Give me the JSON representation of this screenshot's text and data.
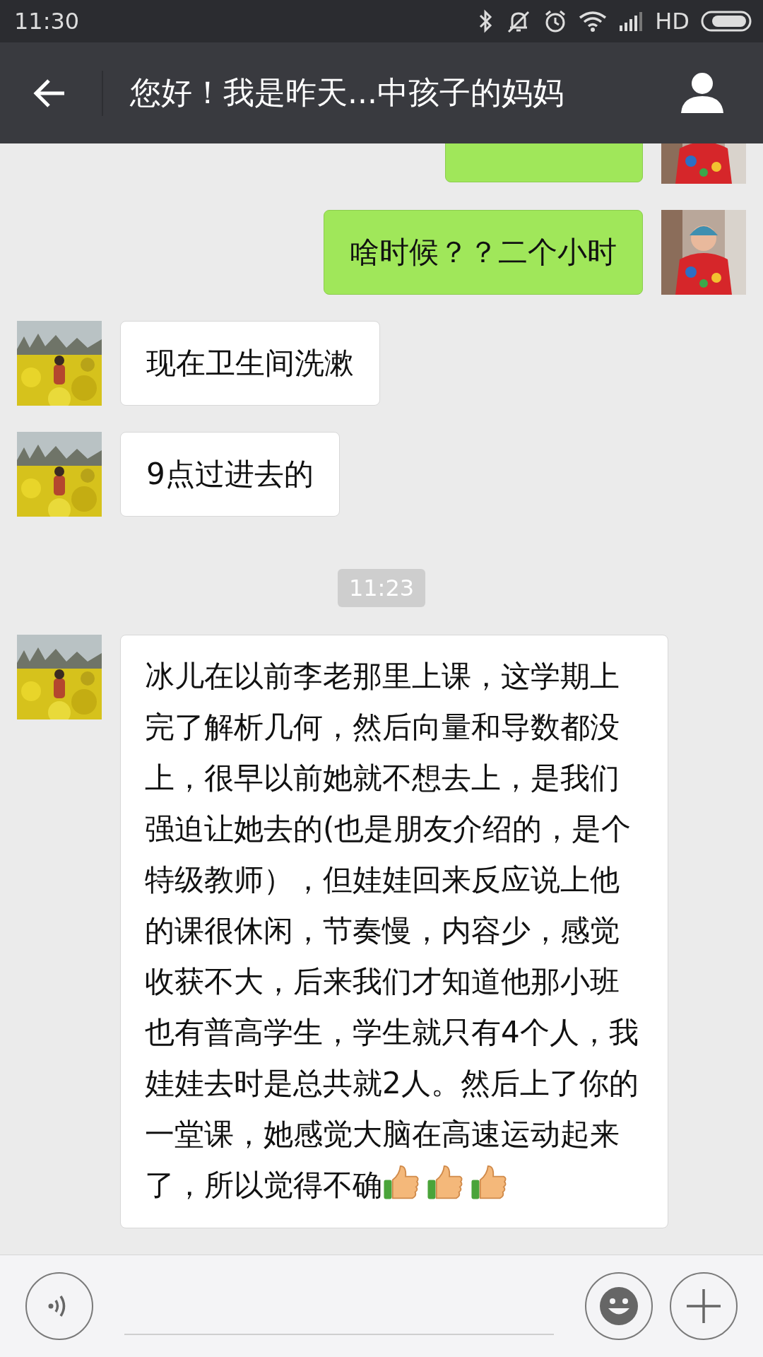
{
  "status_bar": {
    "time": "11:30",
    "network": "HD"
  },
  "header": {
    "title": "您好！我是昨天...中孩子的妈妈"
  },
  "messages": [
    {
      "kind": "sent"
    },
    {
      "kind": "sent",
      "text": "啥时候？？二个小时"
    },
    {
      "kind": "received",
      "text": "现在卫生间洗漱"
    },
    {
      "kind": "received",
      "text": "9点过进去的"
    },
    {
      "kind": "time",
      "text": "11:23"
    },
    {
      "kind": "received",
      "text": "冰儿在以前李老那里上课，这学期上完了解析几何，然后向量和导数都没上，很早以前她就不想去上，是我们强迫让她去的(也是朋友介绍的，是个特级教师），但娃娃回来反应说上他的课很休闲，节奏慢，内容少，感觉收获不大，后来我们才知道他那小班也有普高学生，学生就只有4个人，我娃娃去时是总共就2人。然后上了你的一堂课，她感觉大脑在高速运动起来了，所以觉得不确",
      "reactions": [
        {
          "kind": "thumbs-up"
        },
        {
          "kind": "thumbs-up"
        },
        {
          "kind": "thumbs-up"
        }
      ]
    }
  ]
}
